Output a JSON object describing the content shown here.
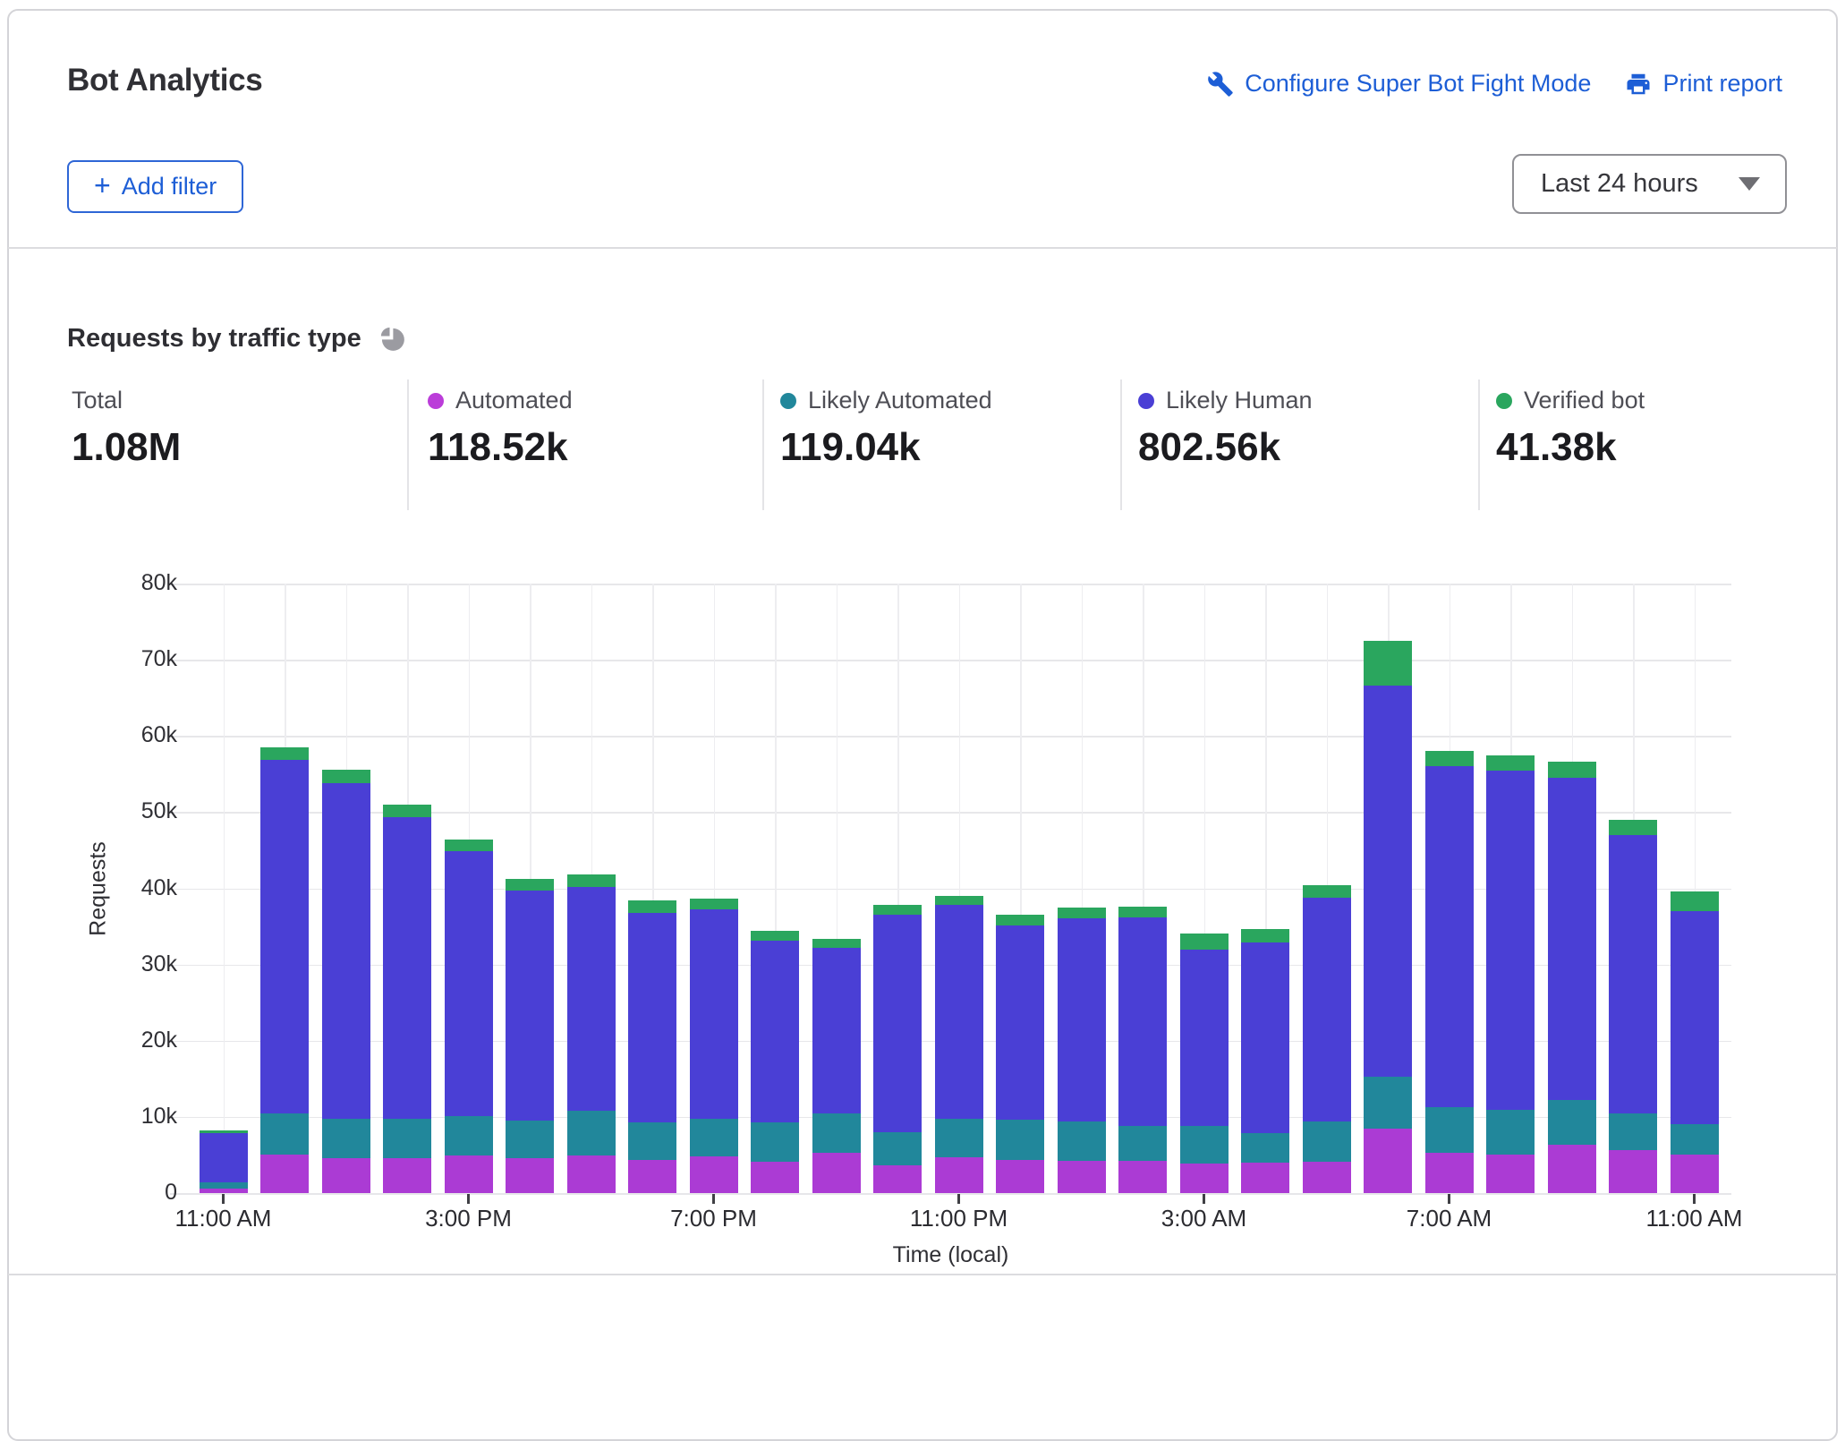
{
  "header": {
    "title": "Bot Analytics",
    "links": [
      {
        "icon": "wrench-icon",
        "label": "Configure Super Bot Fight Mode"
      },
      {
        "icon": "printer-icon",
        "label": "Print report"
      }
    ],
    "add_filter": {
      "icon": "+",
      "label": "Add filter"
    },
    "time_range": {
      "value": "Last 24 hours"
    }
  },
  "section": {
    "title": "Requests by traffic type",
    "stats": [
      {
        "label": "Total",
        "value": "1.08M",
        "dot_color": ""
      },
      {
        "label": "Automated",
        "value": "118.52k",
        "dot_color": "#bb3dd9"
      },
      {
        "label": "Likely Automated",
        "value": "119.04k",
        "dot_color": "#21879b"
      },
      {
        "label": "Likely Human",
        "value": "802.56k",
        "dot_color": "#4a3fd5"
      },
      {
        "label": "Verified bot",
        "value": "41.38k",
        "dot_color": "#2aa65e"
      }
    ]
  },
  "chart_data": {
    "type": "bar",
    "stacked": true,
    "title": "Requests by traffic type",
    "xlabel": "Time (local)",
    "ylabel": "Requests",
    "ylim": [
      0,
      80000
    ],
    "grid": true,
    "units": "thousands of requests",
    "y_tick_labels": [
      "0",
      "10k",
      "20k",
      "30k",
      "40k",
      "50k",
      "60k",
      "70k",
      "80k"
    ],
    "x_tick_labels": [
      "11:00 AM",
      "3:00 PM",
      "7:00 PM",
      "11:00 PM",
      "3:00 AM",
      "7:00 AM",
      "11:00 AM"
    ],
    "x_tick_every": 4,
    "categories": [
      "11:00 AM",
      "12:00 PM",
      "1:00 PM",
      "2:00 PM",
      "3:00 PM",
      "4:00 PM",
      "5:00 PM",
      "6:00 PM",
      "7:00 PM",
      "8:00 PM",
      "9:00 PM",
      "10:00 PM",
      "11:00 PM",
      "12:00 AM",
      "1:00 AM",
      "2:00 AM",
      "3:00 AM",
      "4:00 AM",
      "5:00 AM",
      "6:00 AM",
      "7:00 AM",
      "8:00 AM",
      "9:00 AM",
      "10:00 AM",
      "11:00 AM"
    ],
    "series": [
      {
        "name": "Automated",
        "color": "#ab3bd4",
        "values": [
          0.6,
          5.0,
          4.6,
          4.6,
          4.9,
          4.6,
          4.9,
          4.3,
          4.8,
          4.1,
          5.3,
          3.6,
          4.7,
          4.4,
          4.2,
          4.2,
          3.9,
          4.0,
          4.1,
          8.5,
          5.3,
          5.0,
          6.3,
          5.6,
          5.0
        ]
      },
      {
        "name": "Likely Automated",
        "color": "#21879b",
        "values": [
          0.8,
          5.4,
          5.2,
          5.2,
          5.2,
          4.9,
          5.9,
          5.0,
          4.9,
          5.2,
          5.1,
          4.4,
          5.0,
          5.2,
          5.2,
          4.6,
          4.9,
          3.9,
          5.3,
          6.8,
          6.0,
          5.9,
          5.9,
          4.8,
          4.0
        ]
      },
      {
        "name": "Likely Human",
        "color": "#4a3fd5",
        "values": [
          6.5,
          46.5,
          44.0,
          39.5,
          34.8,
          30.2,
          29.4,
          27.5,
          27.5,
          23.8,
          21.8,
          28.5,
          28.1,
          25.5,
          26.7,
          27.4,
          23.2,
          25.0,
          29.4,
          51.3,
          44.7,
          44.6,
          42.3,
          36.6,
          28.0
        ]
      },
      {
        "name": "Verified bot",
        "color": "#2aa65e",
        "values": [
          0.3,
          1.6,
          1.8,
          1.7,
          1.5,
          1.5,
          1.6,
          1.6,
          1.5,
          1.3,
          1.2,
          1.3,
          1.2,
          1.4,
          1.4,
          1.4,
          2.1,
          1.7,
          1.6,
          5.9,
          2.0,
          1.9,
          2.1,
          2.0,
          2.6
        ]
      }
    ]
  }
}
